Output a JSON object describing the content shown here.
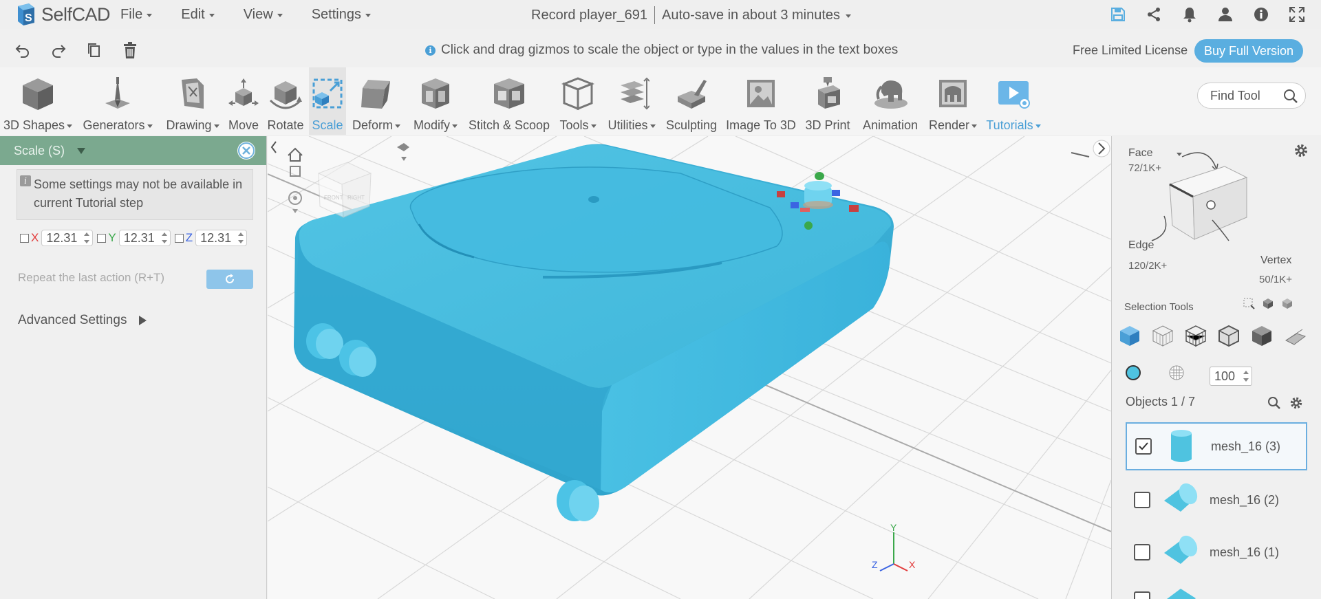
{
  "app": {
    "name": "SelfCAD",
    "doc_title": "Record player_691",
    "autosave": "Auto-save in about 3 minutes"
  },
  "menu": [
    "File",
    "Edit",
    "View",
    "Settings"
  ],
  "top_icons": [
    "save-icon",
    "share-icon",
    "bell-icon",
    "user-icon",
    "info-icon",
    "fullscreen-icon"
  ],
  "hint": "Click and drag gizmos to scale the object or type in the values in the text boxes",
  "license": {
    "text": "Free Limited License",
    "buy_label": "Buy Full Version"
  },
  "toolbar": {
    "items": [
      {
        "label": "3D Shapes",
        "dropdown": true
      },
      {
        "label": "Generators",
        "dropdown": true
      },
      {
        "label": "Drawing",
        "dropdown": true
      },
      {
        "label": "Move",
        "dropdown": false
      },
      {
        "label": "Rotate",
        "dropdown": false
      },
      {
        "label": "Scale",
        "dropdown": false,
        "active": true
      },
      {
        "label": "Deform",
        "dropdown": true
      },
      {
        "label": "Modify",
        "dropdown": true
      },
      {
        "label": "Stitch & Scoop",
        "dropdown": false
      },
      {
        "label": "Tools",
        "dropdown": true
      },
      {
        "label": "Utilities",
        "dropdown": true
      },
      {
        "label": "Sculpting",
        "dropdown": false
      },
      {
        "label": "Image To 3D",
        "dropdown": false
      },
      {
        "label": "3D Print",
        "dropdown": false
      },
      {
        "label": "Animation",
        "dropdown": false
      },
      {
        "label": "Render",
        "dropdown": true
      },
      {
        "label": "Tutorials",
        "dropdown": true
      }
    ],
    "find_placeholder": "Find Tool"
  },
  "scale_panel": {
    "title": "Scale (S)",
    "warning": "Some settings may not be available in current Tutorial step",
    "x_label": "X",
    "y_label": "Y",
    "z_label": "Z",
    "x_value": "12.31",
    "y_value": "12.31",
    "z_value": "12.31",
    "repeat_label": "Repeat the last action (R+T)",
    "advanced_label": "Advanced Settings"
  },
  "colors": {
    "accent": "#4a9fd6",
    "panel_header": "#7ba98f",
    "object": "#4fc3e0",
    "axis_x": "#e23b3b",
    "axis_y": "#3aa84a",
    "axis_z": "#3b64e2"
  },
  "selection": {
    "face_label": "Face",
    "face_count": "72/1K+",
    "edge_label": "Edge",
    "edge_count": "120/2K+",
    "vertex_label": "Vertex",
    "vertex_count": "50/1K+",
    "tools_label": "Selection Tools",
    "opacity": "100"
  },
  "objects": {
    "title": "Objects 1 / 7",
    "items": [
      {
        "name": "mesh_16 (3)",
        "checked": true
      },
      {
        "name": "mesh_16 (2)",
        "checked": false
      },
      {
        "name": "mesh_16 (1)",
        "checked": false
      }
    ]
  },
  "gizmo_axes": {
    "x": "X",
    "y": "Y",
    "z": "Z"
  },
  "view_cube": {
    "front": "FRONT",
    "right": "RIGHT"
  }
}
